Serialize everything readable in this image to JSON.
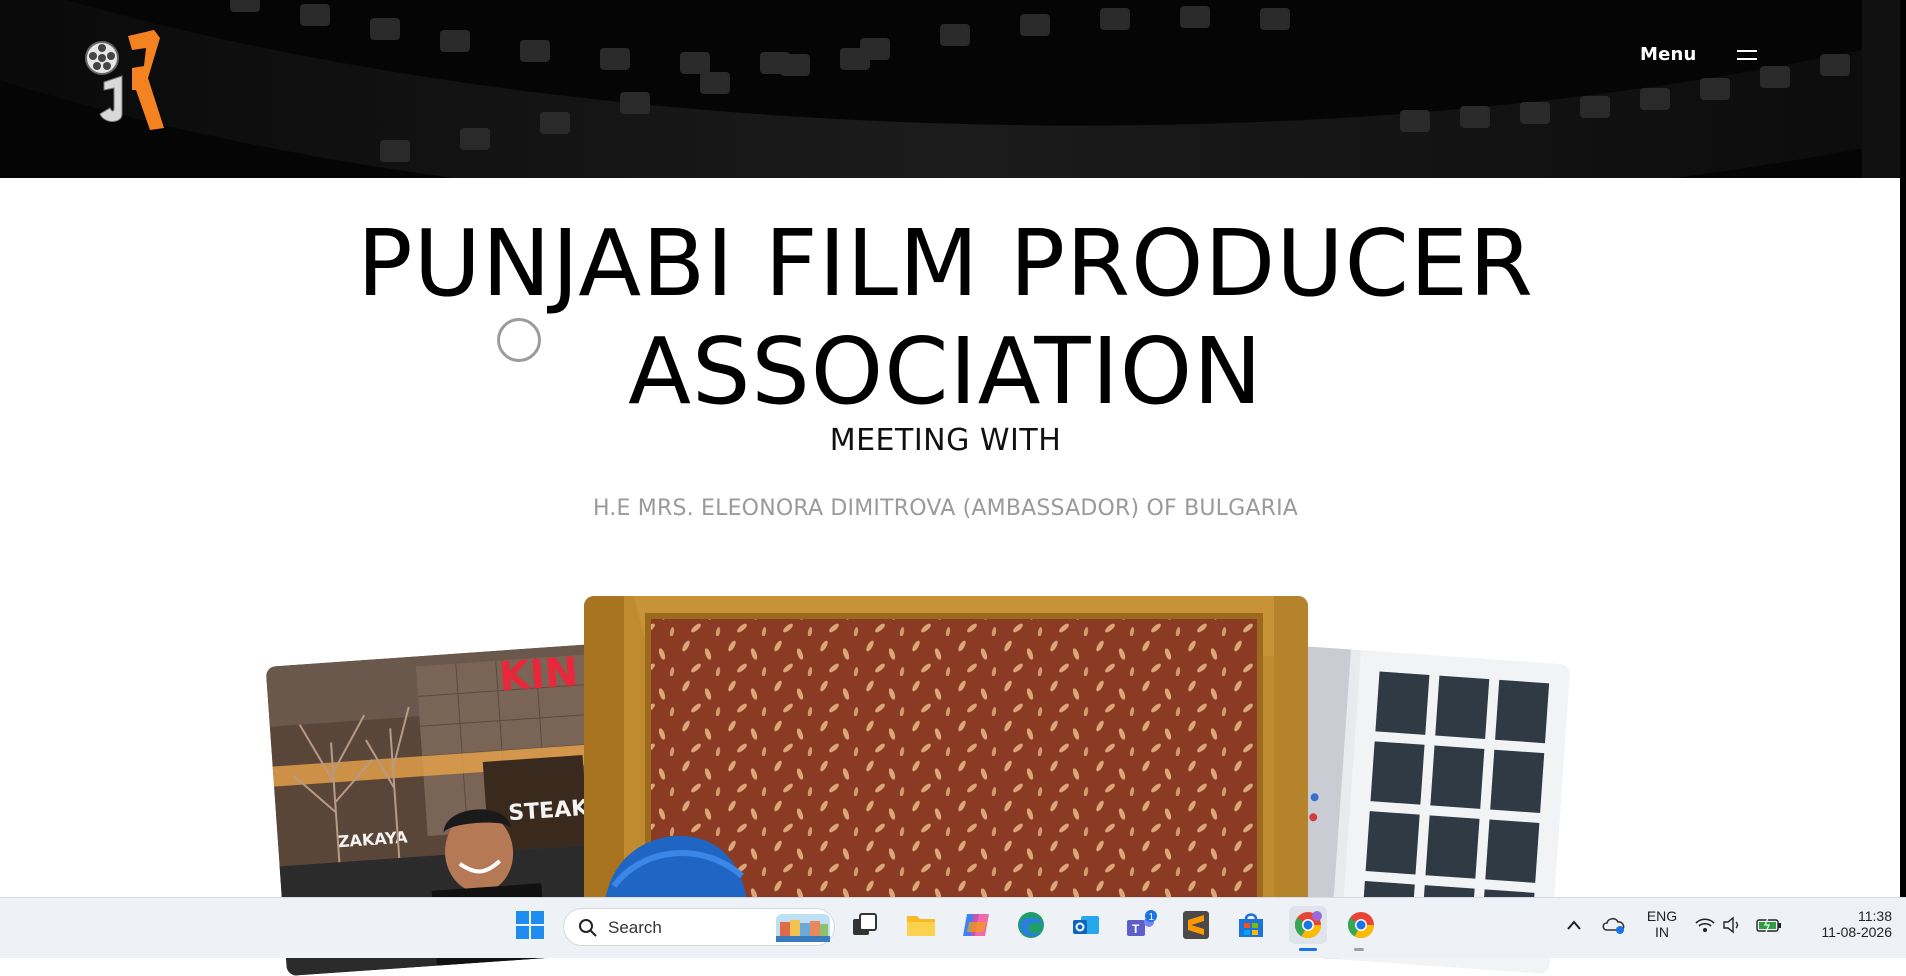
{
  "header": {
    "menu_label": "Menu"
  },
  "hero": {
    "title_line1": "PUNJABI FILM PRODUCER",
    "title_line2": "ASSOCIATION",
    "subtitle": "MEETING WITH",
    "caption": "H.E MRS. ELEONORA DIMITROVA (AMBASSADOR) OF BULGARIA"
  },
  "photos": {
    "left_sign": "KIN",
    "left_sign2": "STEAK",
    "left_sign3": "ZAKAYA"
  },
  "taskbar": {
    "search_placeholder": "Search",
    "teams_badge": "1",
    "language_line1": "ENG",
    "language_line2": "IN",
    "time": "11:38",
    "date": "11-08-2026"
  },
  "colors": {
    "accent_orange": "#f58220",
    "header_bg": "#000000",
    "caption_gray": "#9a9a9a"
  }
}
